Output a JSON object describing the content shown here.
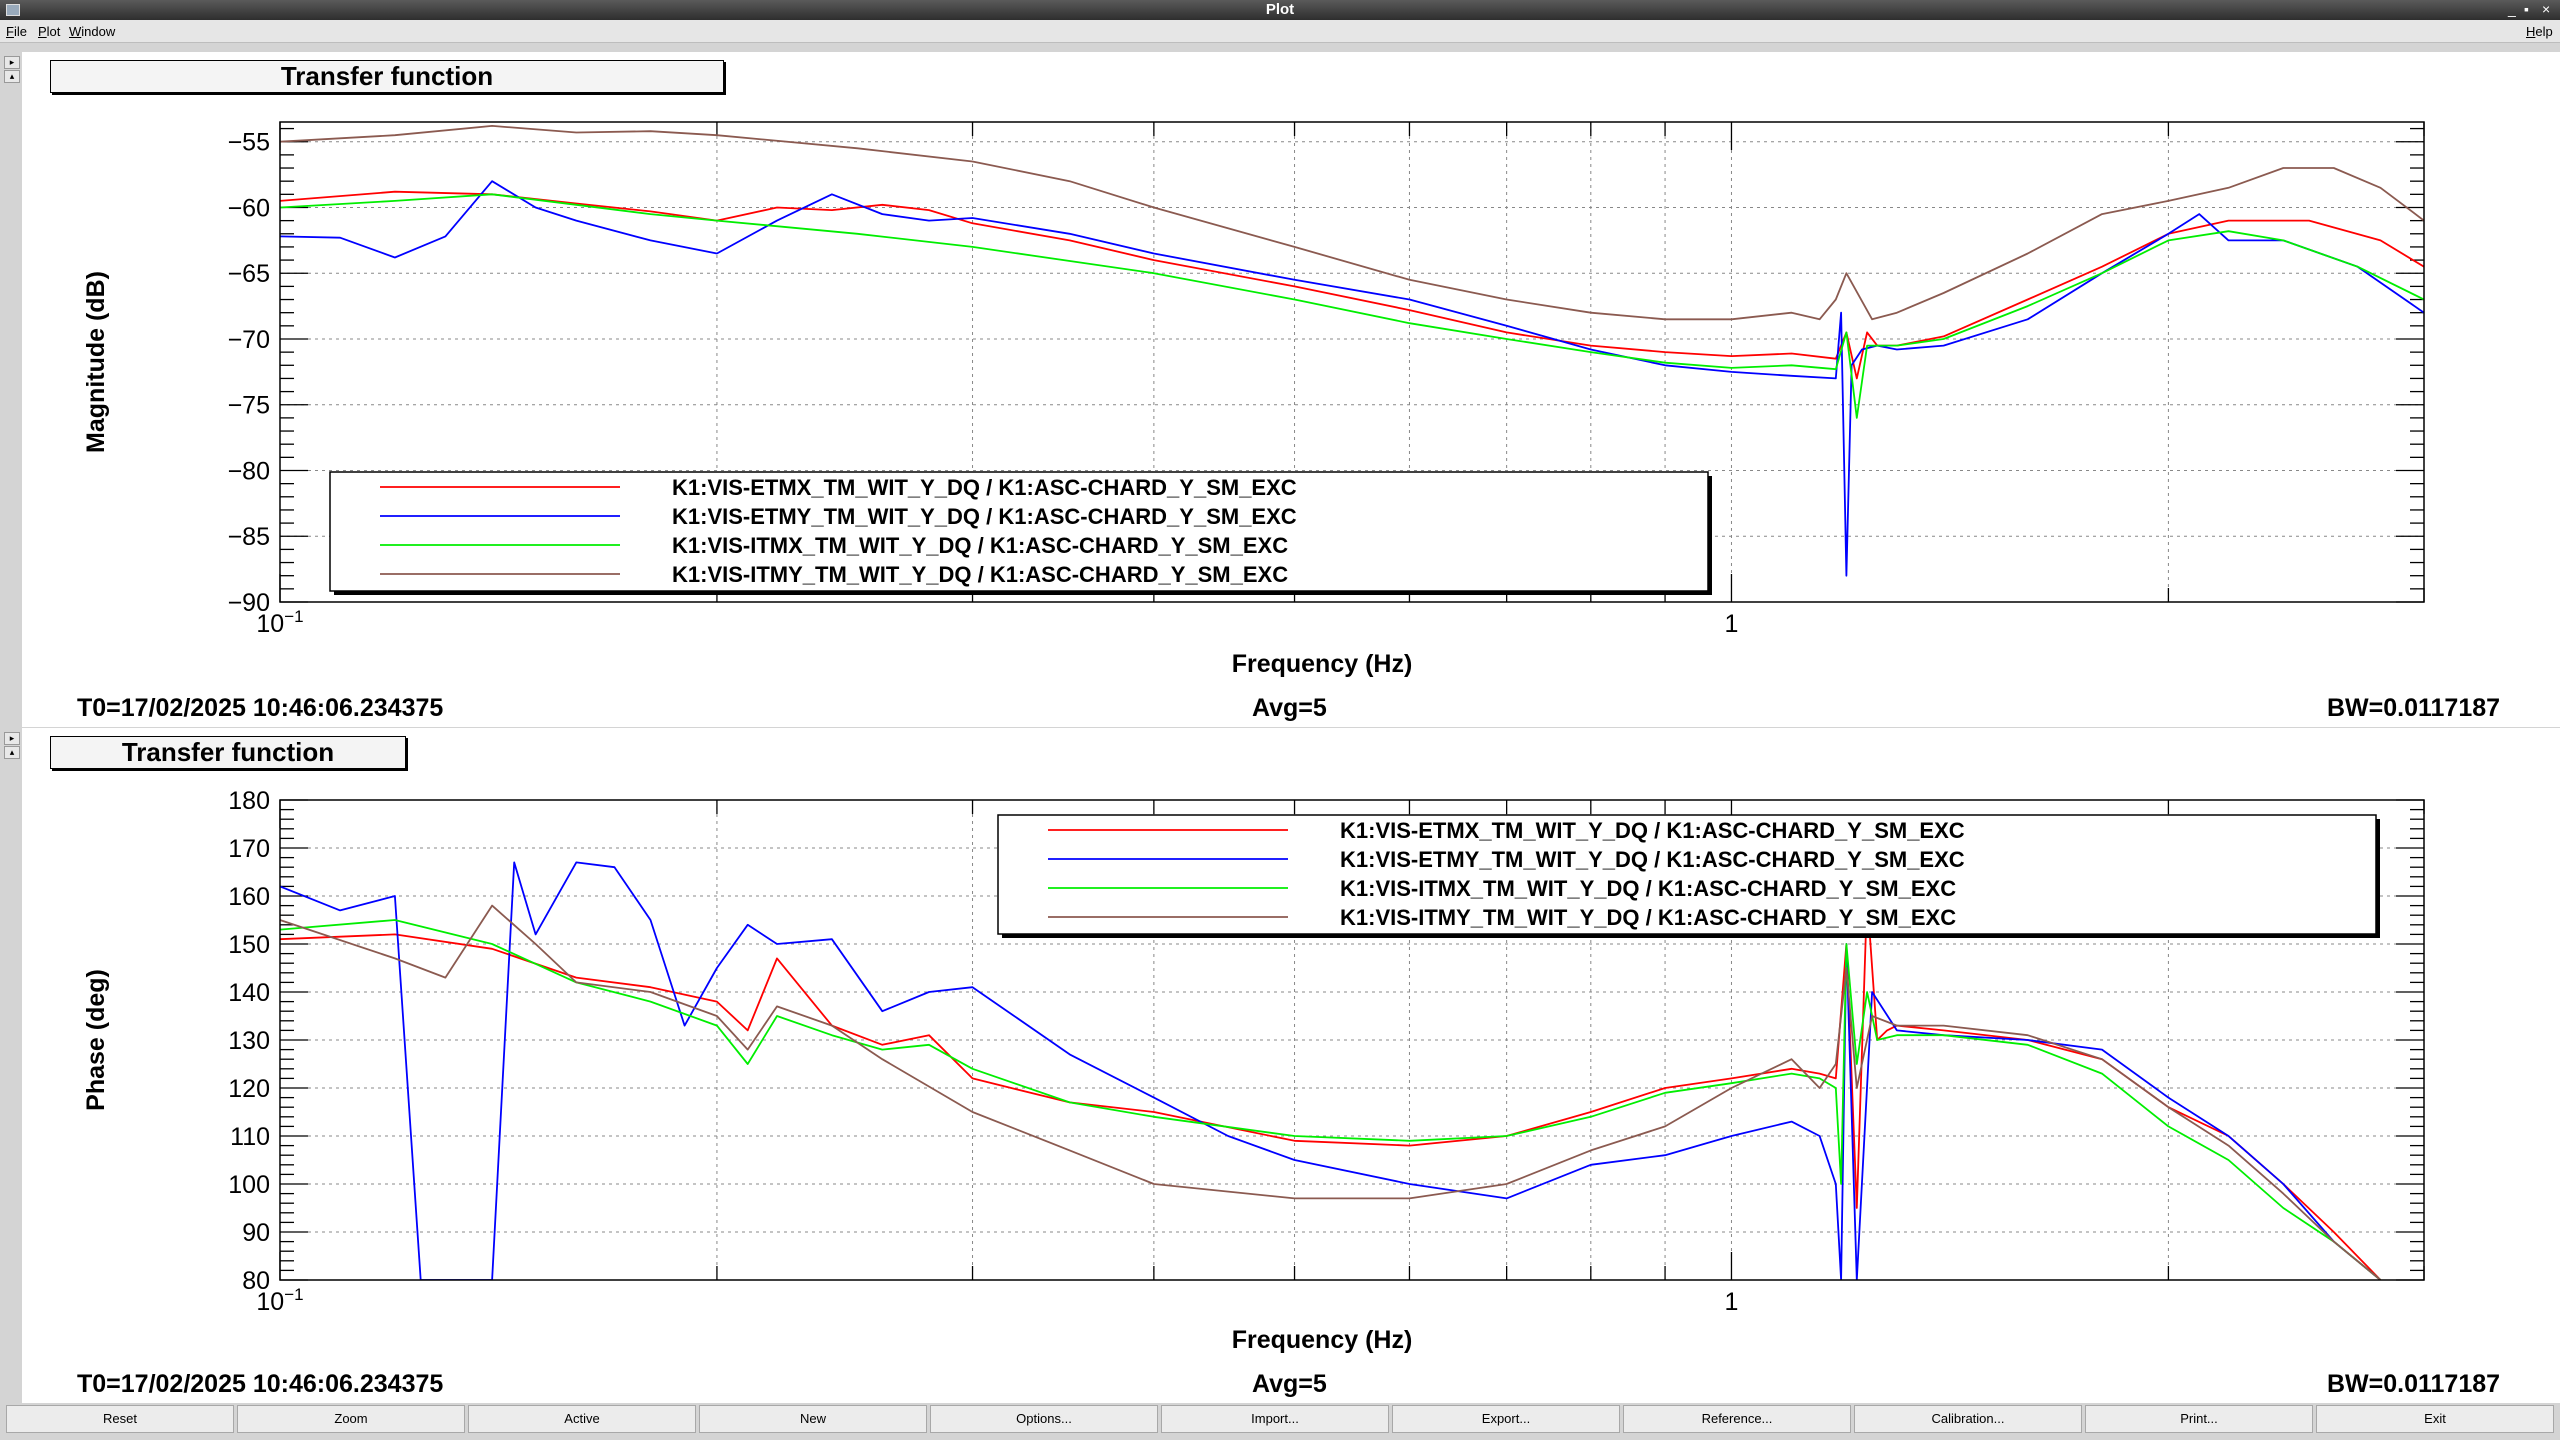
{
  "window": {
    "title": "Plot",
    "controls": [
      "_",
      "▪",
      "×"
    ]
  },
  "menu": {
    "items": [
      "File",
      "Plot",
      "Window"
    ],
    "help": "Help"
  },
  "colors": {
    "red": "#ff0000",
    "blue": "#0000ff",
    "green": "#00ee00",
    "brown": "#8b5a50"
  },
  "panels": [
    {
      "title": "Transfer function",
      "t0": "T0=17/02/2025 10:46:06.234375",
      "avg": "Avg=5",
      "bw": "BW=0.0117187"
    },
    {
      "title": "Transfer function",
      "t0": "T0=17/02/2025 10:46:06.234375",
      "avg": "Avg=5",
      "bw": "BW=0.0117187"
    }
  ],
  "buttons": [
    "Reset",
    "Zoom",
    "Active",
    "New",
    "Options...",
    "Import...",
    "Export...",
    "Reference...",
    "Calibration...",
    "Print...",
    "Exit"
  ],
  "chart_data": [
    {
      "type": "line",
      "xlabel": "Frequency (Hz)",
      "ylabel": "Magnitude (dB)",
      "xscale": "log",
      "xlim": [
        0.1,
        3
      ],
      "ylim": [
        -90,
        -53.5
      ],
      "yticks": [
        -90,
        -85,
        -80,
        -75,
        -70,
        -65,
        -60,
        -55
      ],
      "xtick_labels": [
        {
          "v": 0.1,
          "base": "10",
          "exp": "−1"
        },
        {
          "v": 1,
          "base": "1",
          "exp": ""
        }
      ],
      "grid": true,
      "legend": "bottom-left",
      "series": [
        {
          "name": "K1:VIS-ETMX_TM_WIT_Y_DQ / K1:ASC-CHARD_Y_SM_EXC",
          "color": "#ff0000",
          "x": [
            0.1,
            0.12,
            0.14,
            0.16,
            0.18,
            0.2,
            0.22,
            0.24,
            0.26,
            0.28,
            0.3,
            0.35,
            0.4,
            0.5,
            0.6,
            0.7,
            0.8,
            0.9,
            1.0,
            1.1,
            1.18,
            1.2,
            1.22,
            1.24,
            1.26,
            1.3,
            1.4,
            1.6,
            1.8,
            2.0,
            2.2,
            2.5,
            2.8,
            3.0
          ],
          "y": [
            -59.5,
            -58.8,
            -59.0,
            -59.7,
            -60.3,
            -61.0,
            -60.0,
            -60.2,
            -59.8,
            -60.2,
            -61.2,
            -62.5,
            -64.0,
            -66.0,
            -67.8,
            -69.5,
            -70.5,
            -71.0,
            -71.3,
            -71.1,
            -71.5,
            -69.5,
            -73.0,
            -69.5,
            -70.5,
            -70.5,
            -69.8,
            -67.0,
            -64.5,
            -62.0,
            -61.0,
            -61.0,
            -62.5,
            -64.5
          ]
        },
        {
          "name": "K1:VIS-ETMY_TM_WIT_Y_DQ / K1:ASC-CHARD_Y_SM_EXC",
          "color": "#0000ff",
          "x": [
            0.1,
            0.11,
            0.12,
            0.13,
            0.14,
            0.15,
            0.16,
            0.18,
            0.2,
            0.22,
            0.24,
            0.26,
            0.28,
            0.3,
            0.35,
            0.4,
            0.5,
            0.6,
            0.7,
            0.8,
            0.9,
            1.0,
            1.1,
            1.18,
            1.19,
            1.2,
            1.21,
            1.23,
            1.26,
            1.3,
            1.4,
            1.6,
            1.8,
            2.0,
            2.1,
            2.2,
            2.4,
            2.7,
            3.0
          ],
          "y": [
            -62.2,
            -62.3,
            -63.8,
            -62.2,
            -58.0,
            -60.0,
            -61.0,
            -62.5,
            -63.5,
            -61.0,
            -59.0,
            -60.5,
            -61.0,
            -60.8,
            -62.0,
            -63.5,
            -65.5,
            -67.0,
            -69.0,
            -70.8,
            -72.0,
            -72.5,
            -72.8,
            -73.0,
            -68.0,
            -88.0,
            -72.0,
            -70.8,
            -70.5,
            -70.8,
            -70.5,
            -68.5,
            -65.0,
            -62.0,
            -60.5,
            -62.5,
            -62.5,
            -64.5,
            -68.0
          ]
        },
        {
          "name": "K1:VIS-ITMX_TM_WIT_Y_DQ / K1:ASC-CHARD_Y_SM_EXC",
          "color": "#00ee00",
          "x": [
            0.1,
            0.12,
            0.14,
            0.16,
            0.18,
            0.2,
            0.25,
            0.3,
            0.4,
            0.5,
            0.6,
            0.7,
            0.8,
            0.9,
            1.0,
            1.1,
            1.18,
            1.2,
            1.22,
            1.24,
            1.3,
            1.4,
            1.6,
            1.8,
            2.0,
            2.2,
            2.4,
            2.7,
            3.0
          ],
          "y": [
            -60.0,
            -59.5,
            -59.0,
            -59.8,
            -60.5,
            -61.0,
            -62.0,
            -63.0,
            -65.0,
            -67.0,
            -68.8,
            -70.0,
            -71.0,
            -71.8,
            -72.2,
            -72.0,
            -72.3,
            -69.5,
            -76.0,
            -70.5,
            -70.5,
            -70.0,
            -67.5,
            -65.0,
            -62.5,
            -61.8,
            -62.5,
            -64.5,
            -67.0
          ]
        },
        {
          "name": "K1:VIS-ITMY_TM_WIT_Y_DQ / K1:ASC-CHARD_Y_SM_EXC",
          "color": "#8b5a50",
          "x": [
            0.1,
            0.12,
            0.14,
            0.16,
            0.18,
            0.2,
            0.25,
            0.3,
            0.35,
            0.4,
            0.5,
            0.6,
            0.7,
            0.8,
            0.9,
            1.0,
            1.1,
            1.15,
            1.18,
            1.2,
            1.25,
            1.3,
            1.4,
            1.6,
            1.8,
            2.0,
            2.2,
            2.4,
            2.6,
            2.8,
            3.0
          ],
          "y": [
            -55.0,
            -54.5,
            -53.8,
            -54.3,
            -54.2,
            -54.5,
            -55.5,
            -56.5,
            -58.0,
            -60.0,
            -63.0,
            -65.5,
            -67.0,
            -68.0,
            -68.5,
            -68.5,
            -68.0,
            -68.5,
            -67.0,
            -65.0,
            -68.5,
            -68.0,
            -66.5,
            -63.5,
            -60.5,
            -59.5,
            -58.5,
            -57.0,
            -57.0,
            -58.5,
            -61.0
          ]
        }
      ]
    },
    {
      "type": "line",
      "xlabel": "Frequency (Hz)",
      "ylabel": "Phase (deg)",
      "xscale": "log",
      "xlim": [
        0.1,
        3
      ],
      "ylim": [
        80,
        180
      ],
      "yticks": [
        80,
        90,
        100,
        110,
        120,
        130,
        140,
        150,
        160,
        170,
        180
      ],
      "xtick_labels": [
        {
          "v": 0.1,
          "base": "10",
          "exp": "−1"
        },
        {
          "v": 1,
          "base": "1",
          "exp": ""
        }
      ],
      "grid": true,
      "legend": "top-right",
      "series": [
        {
          "name": "K1:VIS-ETMX_TM_WIT_Y_DQ / K1:ASC-CHARD_Y_SM_EXC",
          "color": "#ff0000",
          "x": [
            0.1,
            0.12,
            0.14,
            0.16,
            0.18,
            0.2,
            0.21,
            0.22,
            0.24,
            0.26,
            0.28,
            0.3,
            0.35,
            0.4,
            0.5,
            0.6,
            0.7,
            0.8,
            0.9,
            1.0,
            1.1,
            1.15,
            1.18,
            1.2,
            1.22,
            1.24,
            1.26,
            1.28,
            1.3,
            1.4,
            1.6,
            1.8,
            2.0,
            2.2,
            2.4,
            2.6,
            2.8
          ],
          "y": [
            151,
            152,
            149,
            143,
            141,
            138,
            132,
            147,
            133,
            129,
            131,
            122,
            117,
            115,
            109,
            108,
            110,
            115,
            120,
            122,
            124,
            123,
            122,
            150,
            95,
            160,
            130,
            132,
            133,
            132,
            130,
            126,
            116,
            110,
            100,
            90,
            80
          ]
        },
        {
          "name": "K1:VIS-ETMY_TM_WIT_Y_DQ / K1:ASC-CHARD_Y_SM_EXC",
          "color": "#0000ff",
          "x": [
            0.1,
            0.11,
            0.12,
            0.125,
            0.13,
            0.14,
            0.145,
            0.15,
            0.16,
            0.17,
            0.18,
            0.19,
            0.2,
            0.21,
            0.22,
            0.24,
            0.26,
            0.28,
            0.3,
            0.35,
            0.4,
            0.45,
            0.5,
            0.6,
            0.7,
            0.8,
            0.9,
            1.0,
            1.1,
            1.15,
            1.18,
            1.19,
            1.2,
            1.22,
            1.25,
            1.3,
            1.4,
            1.6,
            1.8,
            2.0,
            2.2,
            2.4,
            2.6,
            2.8
          ],
          "y": [
            162,
            157,
            160,
            80,
            80,
            80,
            167,
            152,
            167,
            166,
            155,
            133,
            145,
            154,
            150,
            151,
            136,
            140,
            141,
            127,
            118,
            110,
            105,
            100,
            97,
            104,
            106,
            110,
            113,
            110,
            100,
            80,
            150,
            80,
            140,
            132,
            131,
            130,
            128,
            118,
            110,
            100,
            88,
            80
          ]
        },
        {
          "name": "K1:VIS-ITMX_TM_WIT_Y_DQ / K1:ASC-CHARD_Y_SM_EXC",
          "color": "#00ee00",
          "x": [
            0.1,
            0.12,
            0.14,
            0.16,
            0.18,
            0.2,
            0.21,
            0.22,
            0.24,
            0.26,
            0.28,
            0.3,
            0.35,
            0.4,
            0.5,
            0.6,
            0.7,
            0.8,
            0.9,
            1.0,
            1.1,
            1.15,
            1.18,
            1.19,
            1.2,
            1.22,
            1.24,
            1.26,
            1.3,
            1.4,
            1.6,
            1.8,
            2.0,
            2.2,
            2.4,
            2.6,
            2.8
          ],
          "y": [
            153,
            155,
            150,
            142,
            138,
            133,
            125,
            135,
            131,
            128,
            129,
            124,
            117,
            114,
            110,
            109,
            110,
            114,
            119,
            121,
            123,
            122,
            120,
            100,
            150,
            125,
            140,
            130,
            131,
            131,
            129,
            123,
            112,
            105,
            95,
            88,
            80
          ]
        },
        {
          "name": "K1:VIS-ITMY_TM_WIT_Y_DQ / K1:ASC-CHARD_Y_SM_EXC",
          "color": "#8b5a50",
          "x": [
            0.1,
            0.12,
            0.13,
            0.14,
            0.15,
            0.16,
            0.18,
            0.2,
            0.21,
            0.22,
            0.24,
            0.26,
            0.3,
            0.35,
            0.4,
            0.5,
            0.6,
            0.7,
            0.8,
            0.9,
            1.0,
            1.1,
            1.15,
            1.18,
            1.2,
            1.22,
            1.25,
            1.3,
            1.4,
            1.6,
            1.8,
            2.0,
            2.2,
            2.4,
            2.6,
            2.8
          ],
          "y": [
            155,
            147,
            143,
            158,
            150,
            142,
            140,
            135,
            128,
            137,
            133,
            126,
            115,
            107,
            100,
            97,
            97,
            100,
            107,
            112,
            120,
            126,
            120,
            125,
            145,
            120,
            135,
            133,
            133,
            131,
            126,
            116,
            108,
            98,
            88,
            80
          ]
        }
      ]
    }
  ]
}
